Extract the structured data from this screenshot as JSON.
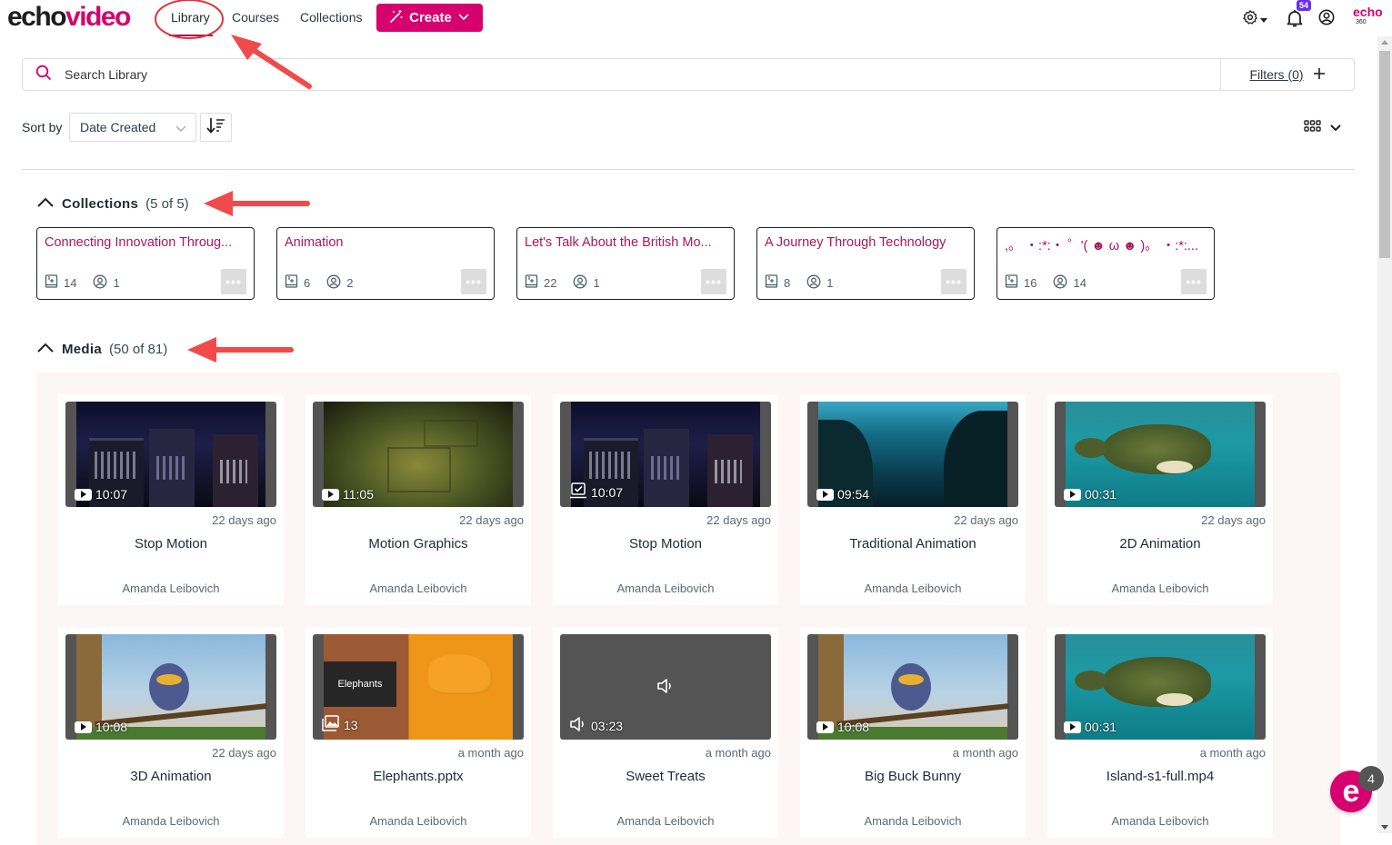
{
  "app": {
    "logo_part1": "echo",
    "logo_part2": "video",
    "brand_color": "#d6006f"
  },
  "nav": {
    "items": [
      {
        "label": "Library",
        "active": true
      },
      {
        "label": "Courses",
        "active": false
      },
      {
        "label": "Collections",
        "active": false
      }
    ],
    "create_label": "Create",
    "notifications_count": "54",
    "echo360_label": "echo",
    "echo360_sub": "360"
  },
  "search": {
    "placeholder": "Search Library",
    "value": "",
    "filters_label": "Filters (0)"
  },
  "sort": {
    "label": "Sort by",
    "selected": "Date Created"
  },
  "collections_section": {
    "title": "Collections",
    "count": "(5 of 5)",
    "items": [
      {
        "title": "Connecting Innovation Throug...",
        "media": "14",
        "members": "1"
      },
      {
        "title": "Animation",
        "media": "6",
        "members": "2"
      },
      {
        "title": "Let's Talk About the British Mo...",
        "media": "22",
        "members": "1"
      },
      {
        "title": "A Journey Through Technology",
        "media": "8",
        "members": "1"
      },
      {
        "title": ",。 ・:*:・ ゜'( ☻ ω ☻ )。 ・:*:...",
        "media": "16",
        "members": "14"
      }
    ]
  },
  "media_section": {
    "title": "Media",
    "count": "(50 of 81)",
    "items": [
      {
        "title": "Stop Motion",
        "date": "22 days ago",
        "owner": "Amanda Leibovich",
        "duration": "10:07",
        "kind": "video",
        "thumb": "castle"
      },
      {
        "title": "Motion Graphics",
        "date": "22 days ago",
        "owner": "Amanda Leibovich",
        "duration": "11:05",
        "kind": "video",
        "thumb": "stone"
      },
      {
        "title": "Stop Motion",
        "date": "22 days ago",
        "owner": "Amanda Leibovich",
        "duration": "10:07",
        "kind": "quiz",
        "thumb": "castle"
      },
      {
        "title": "Traditional Animation",
        "date": "22 days ago",
        "owner": "Amanda Leibovich",
        "duration": "09:54",
        "kind": "video",
        "thumb": "ocean"
      },
      {
        "title": "2D Animation",
        "date": "22 days ago",
        "owner": "Amanda Leibovich",
        "duration": "00:31",
        "kind": "video",
        "thumb": "island"
      },
      {
        "title": "3D Animation",
        "date": "22 days ago",
        "owner": "Amanda Leibovich",
        "duration": "10:08",
        "kind": "video",
        "thumb": "bird"
      },
      {
        "title": "Elephants.pptx",
        "date": "a month ago",
        "owner": "Amanda Leibovich",
        "duration": "13",
        "kind": "slides",
        "thumb": "elephant",
        "slide_title": "Elephants"
      },
      {
        "title": "Sweet Treats",
        "date": "a month ago",
        "owner": "Amanda Leibovich",
        "duration": "03:23",
        "kind": "audio",
        "thumb": "audio"
      },
      {
        "title": "Big Buck Bunny",
        "date": "a month ago",
        "owner": "Amanda Leibovich",
        "duration": "10:08",
        "kind": "video",
        "thumb": "bird"
      },
      {
        "title": "Island-s1-full.mp4",
        "date": "a month ago",
        "owner": "Amanda Leibovich",
        "duration": "00:31",
        "kind": "video",
        "thumb": "island"
      }
    ]
  },
  "chat_widget": {
    "badge": "4"
  }
}
